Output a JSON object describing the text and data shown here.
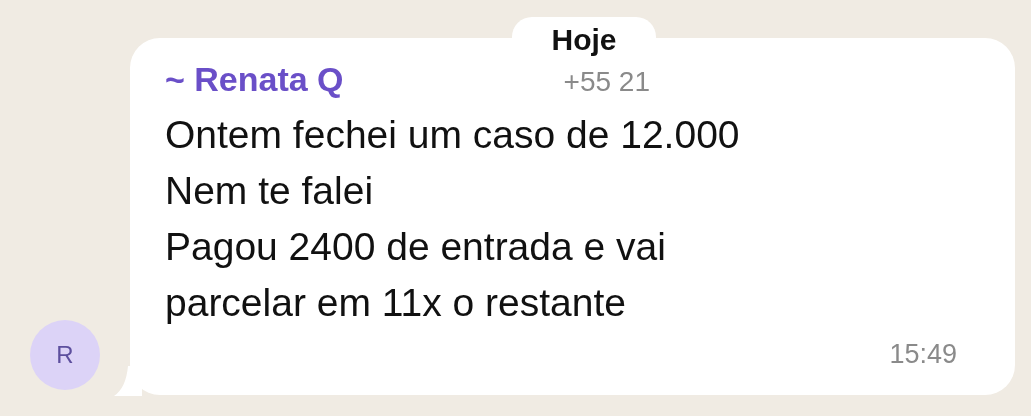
{
  "date_pill": "Hoje",
  "message": {
    "sender": "~ Renata Q",
    "phone": "+55 21",
    "avatar_letter": "R",
    "lines": [
      "Ontem fechei um caso de 12.000",
      "Nem te falei",
      "Pagou 2400 de entrada e vai",
      "parcelar em 11x o restante"
    ],
    "time": "15:49"
  }
}
